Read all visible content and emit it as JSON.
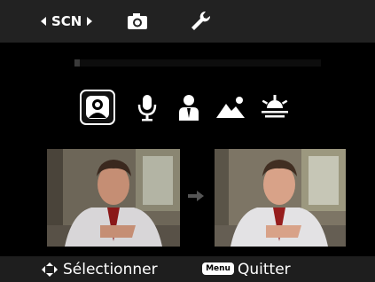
{
  "top_bar": {
    "mode_label": "SCN",
    "icons": [
      "camera-icon",
      "wrench-icon"
    ]
  },
  "progress": {
    "value": 0.02
  },
  "scene_modes": [
    {
      "icon": "portrait-icon",
      "selected": true
    },
    {
      "icon": "microphone-icon",
      "selected": false
    },
    {
      "icon": "business-portrait-icon",
      "selected": false
    },
    {
      "icon": "landscape-icon",
      "selected": false
    },
    {
      "icon": "sunset-icon",
      "selected": false
    }
  ],
  "bottom_bar": {
    "select_label": "Sélectionner",
    "menu_badge": "Menu",
    "quit_label": "Quitter"
  }
}
